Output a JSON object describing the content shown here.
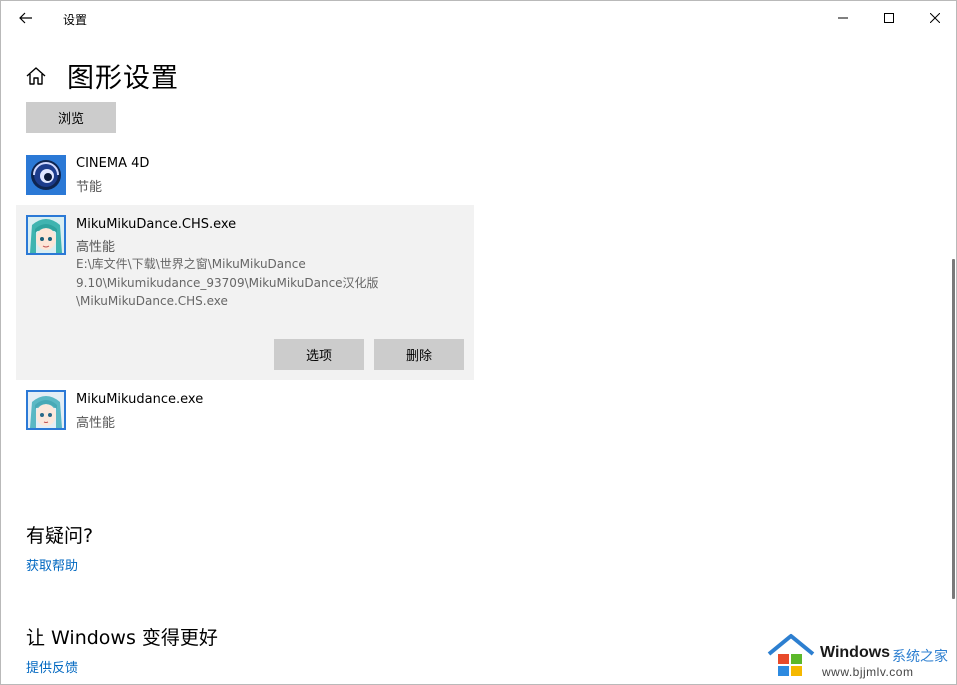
{
  "window": {
    "title": "设置"
  },
  "page": {
    "title": "图形设置"
  },
  "browse_label": "浏览",
  "apps": [
    {
      "name": "CINEMA 4D",
      "preference": "节能",
      "icon": "cinema4d-icon"
    },
    {
      "name": "MikuMikuDance.CHS.exe",
      "preference": "高性能",
      "path_lines": [
        "E:\\库文件\\下载\\世界之窗\\MikuMikuDance",
        "9.10\\Mikumikudance_93709\\MikuMikuDance汉化版",
        "\\MikuMikuDance.CHS.exe"
      ],
      "options_label": "选项",
      "remove_label": "删除",
      "icon": "miku-icon",
      "selected": true
    },
    {
      "name": "MikuMikudance.exe",
      "preference": "高性能",
      "icon": "miku-icon"
    }
  ],
  "help": {
    "title": "有疑问?",
    "link": "获取帮助"
  },
  "feedback": {
    "title": "让 Windows 变得更好",
    "link": "提供反馈"
  },
  "watermark": {
    "brand": "Windows",
    "site_name": "系统之家",
    "url": "www.bjjmlv.com"
  },
  "colors": {
    "accent": "#0067c0",
    "selected_bg": "#f2f2f2",
    "button_bg": "#cccccc"
  }
}
